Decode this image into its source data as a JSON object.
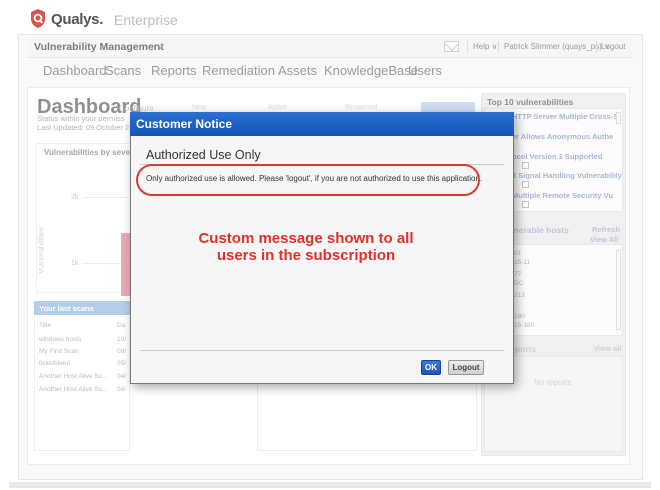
{
  "brand": {
    "name": "Qualys.",
    "edition": "Enterprise",
    "color": "#d9534f"
  },
  "topbar": {
    "module": "Vulnerability Management",
    "help": "Help ∨",
    "user": "Patrick Slimmer (quays_ps) ∨",
    "logout": "Logout"
  },
  "nav": [
    "Dashboard",
    "Scans",
    "Reports",
    "Remediation",
    "Assets",
    "KnowledgeBase",
    "Users"
  ],
  "dashboard": {
    "title": "Dashboard",
    "title_sub": "Configure",
    "status": "Status within your permiss",
    "updated": "Last Updated: 09 October 2",
    "col_new": "New",
    "col_active": "Active",
    "col_reopened": "Reopened",
    "severity_title": "Vulnerabilities by severit",
    "axis_2k": "2k",
    "axis_1k": "1k",
    "axis_label": "Vulnerabilities",
    "severity_bar_fraction": 0.6
  },
  "last_scans": {
    "title": "Your last scans",
    "col_title": "Title",
    "col_date": "Da",
    "rows": [
      {
        "title": "windows hosts",
        "date": "10/"
      },
      {
        "title": "My First Scan",
        "date": "09/"
      },
      {
        "title": "ticketbleed",
        "date": "05/"
      },
      {
        "title": "Another Host Alive Sc...",
        "date": "04/"
      },
      {
        "title": "Another Host Alive Sc...",
        "date": "04/"
      }
    ]
  },
  "right": {
    "top_vulns_title": "Top 10 vulnerabilities",
    "vulns": [
      "HTTP Server Multiple Cross-S",
      "er Allows Anonymous Authe",
      "ocol Version 1 Supported",
      "3 Signal Handling Vulnerability",
      "Multiple Remote Security Vu"
    ],
    "hosts_title": "ulnerable hosts",
    "refresh": "Refresh",
    "view_all": "View All",
    "hosts": [
      "91",
      "15-11",
      "77",
      "DC",
      "213",
      "",
      "180",
      "15-180"
    ],
    "reports_title": "reports",
    "reports_view_all": "View all",
    "no_reports": "No reports"
  },
  "modal": {
    "title": "Customer Notice",
    "heading": "Authorized Use Only",
    "message": "Only authorized use is allowed. Please 'logout', if you are not authorized to use this application.",
    "annotation": "Custom message shown to all users in the subscription",
    "ok": "OK",
    "logout": "Logout"
  }
}
